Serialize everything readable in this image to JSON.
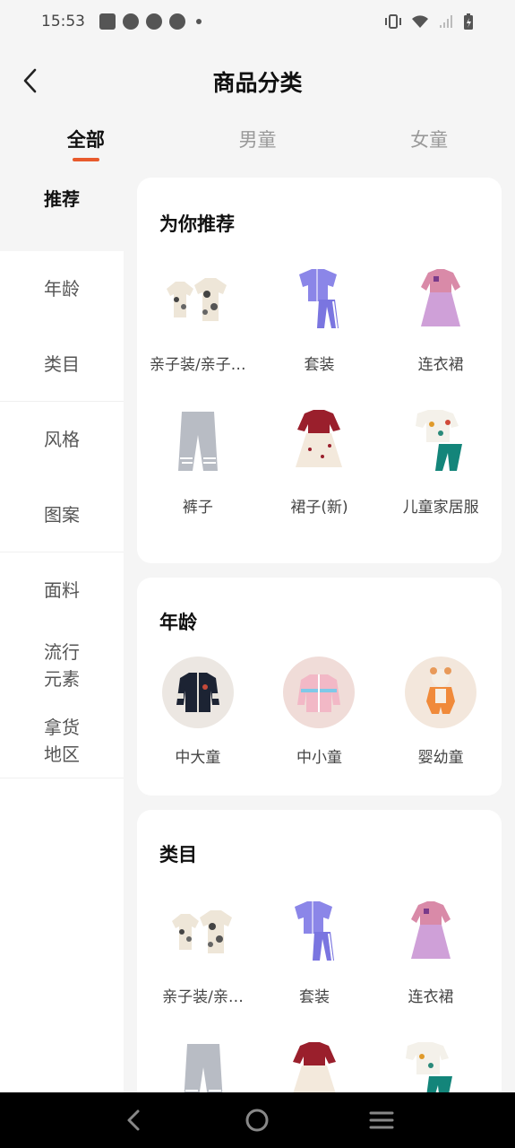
{
  "status_bar": {
    "time": "15:53"
  },
  "header": {
    "title": "商品分类"
  },
  "tabs": [
    {
      "label": "全部"
    },
    {
      "label": "男童"
    },
    {
      "label": "女童"
    }
  ],
  "sidebar": {
    "items": [
      {
        "label": "推荐"
      },
      {
        "label": "年龄"
      },
      {
        "label": "类目"
      },
      {
        "label": "风格"
      },
      {
        "label": "图案"
      },
      {
        "label": "面料"
      },
      {
        "label": "流行元素"
      },
      {
        "label": "拿货地区"
      }
    ]
  },
  "sections": {
    "recommend": {
      "title": "为你推荐",
      "items": [
        {
          "label": "亲子装/亲子…"
        },
        {
          "label": "套装"
        },
        {
          "label": "连衣裙"
        },
        {
          "label": "裤子"
        },
        {
          "label": "裙子(新)"
        },
        {
          "label": "儿童家居服"
        }
      ]
    },
    "age": {
      "title": "年龄",
      "items": [
        {
          "label": "中大童"
        },
        {
          "label": "中小童"
        },
        {
          "label": "婴幼童"
        }
      ]
    },
    "category": {
      "title": "类目",
      "items": [
        {
          "label": "亲子装/亲…"
        },
        {
          "label": "套装"
        },
        {
          "label": "连衣裙"
        }
      ]
    }
  },
  "colors": {
    "accent": "#e85a2c",
    "background": "#f5f5f5"
  }
}
